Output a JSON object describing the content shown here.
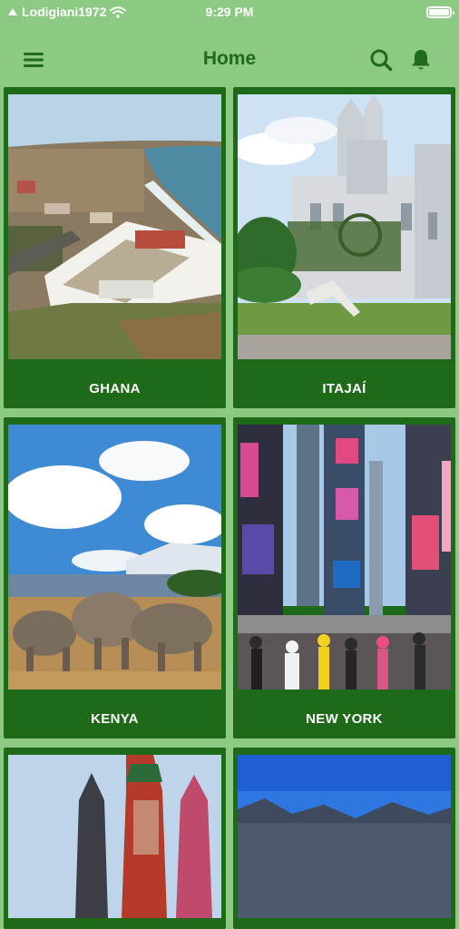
{
  "status_bar": {
    "carrier": "Lodigiani1972",
    "time": "9:29 PM"
  },
  "header": {
    "title": "Home"
  },
  "colors": {
    "background": "#8cc983",
    "card": "#1f6a18",
    "title": "#1f6b1a"
  },
  "destinations": [
    {
      "label": "GHANA"
    },
    {
      "label": "ITAJAÍ"
    },
    {
      "label": "KENYA"
    },
    {
      "label": "NEW YORK"
    },
    {
      "label": ""
    },
    {
      "label": ""
    }
  ]
}
